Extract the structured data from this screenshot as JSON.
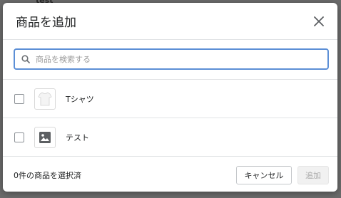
{
  "background": {
    "hint_text": "test"
  },
  "modal": {
    "title": "商品を追加",
    "search": {
      "placeholder": "商品を検索する",
      "value": ""
    },
    "products": [
      {
        "name": "Tシャツ",
        "thumbnail": "tshirt-photo",
        "checked": false
      },
      {
        "name": "テスト",
        "thumbnail": "image-placeholder-icon",
        "checked": false
      }
    ],
    "footer": {
      "selected_count_text": "0件の商品を選択済",
      "cancel_label": "キャンセル",
      "add_label": "追加"
    }
  },
  "colors": {
    "accent": "#5c8fd6",
    "overlay": "#6b6b6b",
    "disabled_button": "#f1f1f1"
  }
}
